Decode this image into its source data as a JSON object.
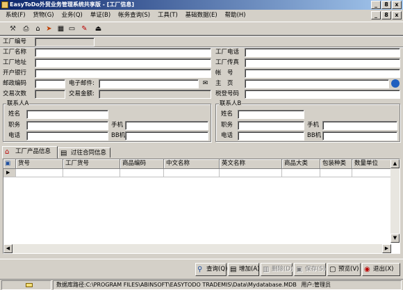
{
  "window": {
    "title": "EasyToDo外贸业务管理系统共享版 - [工厂信息]",
    "buttons": [
      "_",
      "8",
      "x"
    ]
  },
  "menu": {
    "items": [
      "系统(F)",
      "货物(G)",
      "业务(Q)",
      "单证(B)",
      "帐务查询(S)",
      "工具(T)",
      "基础数据(E)",
      "帮助(H)"
    ]
  },
  "form": {
    "factory_no_label": "工厂编号",
    "factory_no": "",
    "factory_name_label": "工厂名称",
    "factory_name": "",
    "factory_phone_label": "工厂电话",
    "factory_phone": "",
    "factory_address_label": "工厂地址",
    "factory_address": "",
    "factory_fax_label": "工厂传真",
    "factory_fax": "",
    "bank_label": "开户银行",
    "bank": "",
    "account_label": "帐　号",
    "account": "",
    "zip_label": "邮政编码",
    "zip": "",
    "email_label": "电子邮件:",
    "email": "",
    "homepage_label": "主　页",
    "homepage": "",
    "trade_count_label": "交易次数",
    "trade_count": "",
    "trade_amount_label": "交易金额:",
    "trade_amount": "",
    "tax_no_label": "税登号码",
    "tax_no": ""
  },
  "contact_a": {
    "title": "联系人A",
    "name_label": "姓名",
    "position_label": "职务",
    "mobile_label": "手机",
    "phone_label": "电话",
    "bb_label": "BB机",
    "name": "",
    "position": "",
    "mobile": "",
    "phone": "",
    "bb": ""
  },
  "contact_b": {
    "title": "联系人B",
    "name_label": "姓名",
    "position_label": "职务",
    "mobile_label": "手机",
    "phone_label": "电话",
    "bb_label": "BB机",
    "name": "",
    "position": "",
    "mobile": "",
    "phone": "",
    "bb": ""
  },
  "tabs": [
    "工厂产品信息",
    "过往合同信息"
  ],
  "grid": {
    "columns": [
      "货号",
      "工厂货号",
      "商品编码",
      "中文名称",
      "英文名称",
      "商品大类",
      "包装种类",
      "数量单位"
    ]
  },
  "buttons": {
    "query": "查询(Q)",
    "add": "增加(A)",
    "delete": "删除(D)",
    "save": "保存(S)",
    "preview": "预览(V)",
    "exit": "退出(X)"
  },
  "status": {
    "db_path": "数据库路径:C:\\PROGRAM FILES\\ABINSOFT\\EASYTODO TRADEMIS\\Data\\Mydatabase.MDB",
    "user": "用户:管理员"
  },
  "colors": {
    "title_start": "#0a246a",
    "title_end": "#a6caf0",
    "face": "#d4d0c8"
  }
}
